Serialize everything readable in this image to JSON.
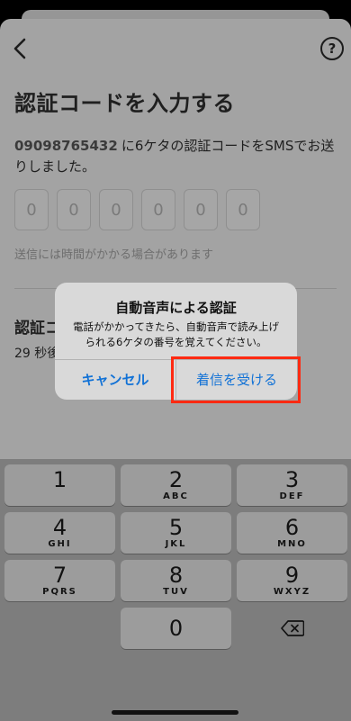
{
  "header": {
    "back_icon": "chevron-left-icon",
    "help_icon": "question-circle-icon",
    "help_symbol": "?"
  },
  "page": {
    "title": "認証コードを入力する",
    "phone_number": "09098765432",
    "instruction": "に6ケタの認証コードをSMSでお送りしました。",
    "code_digits": [
      "0",
      "0",
      "0",
      "0",
      "0",
      "0"
    ],
    "hint": "送信には時間がかかる場合があります",
    "alt_title": "認証コ",
    "countdown": "29 秒後"
  },
  "alert": {
    "title": "自動音声による認証",
    "message": "電話がかかってきたら、自動音声で読み上げられる6ケタの番号を覚えてください。",
    "cancel_label": "キャンセル",
    "accept_label": "着信を受ける"
  },
  "keyboard": {
    "keys": [
      {
        "digit": "1",
        "letters": ""
      },
      {
        "digit": "2",
        "letters": "ABC"
      },
      {
        "digit": "3",
        "letters": "DEF"
      },
      {
        "digit": "4",
        "letters": "GHI"
      },
      {
        "digit": "5",
        "letters": "JKL"
      },
      {
        "digit": "6",
        "letters": "MNO"
      },
      {
        "digit": "7",
        "letters": "PQRS"
      },
      {
        "digit": "8",
        "letters": "TUV"
      },
      {
        "digit": "9",
        "letters": "WXYZ"
      },
      {
        "digit": "0",
        "letters": ""
      }
    ],
    "delete_icon": "backspace-icon"
  },
  "colors": {
    "accent": "#1272d6",
    "highlight": "#ff2a12"
  }
}
